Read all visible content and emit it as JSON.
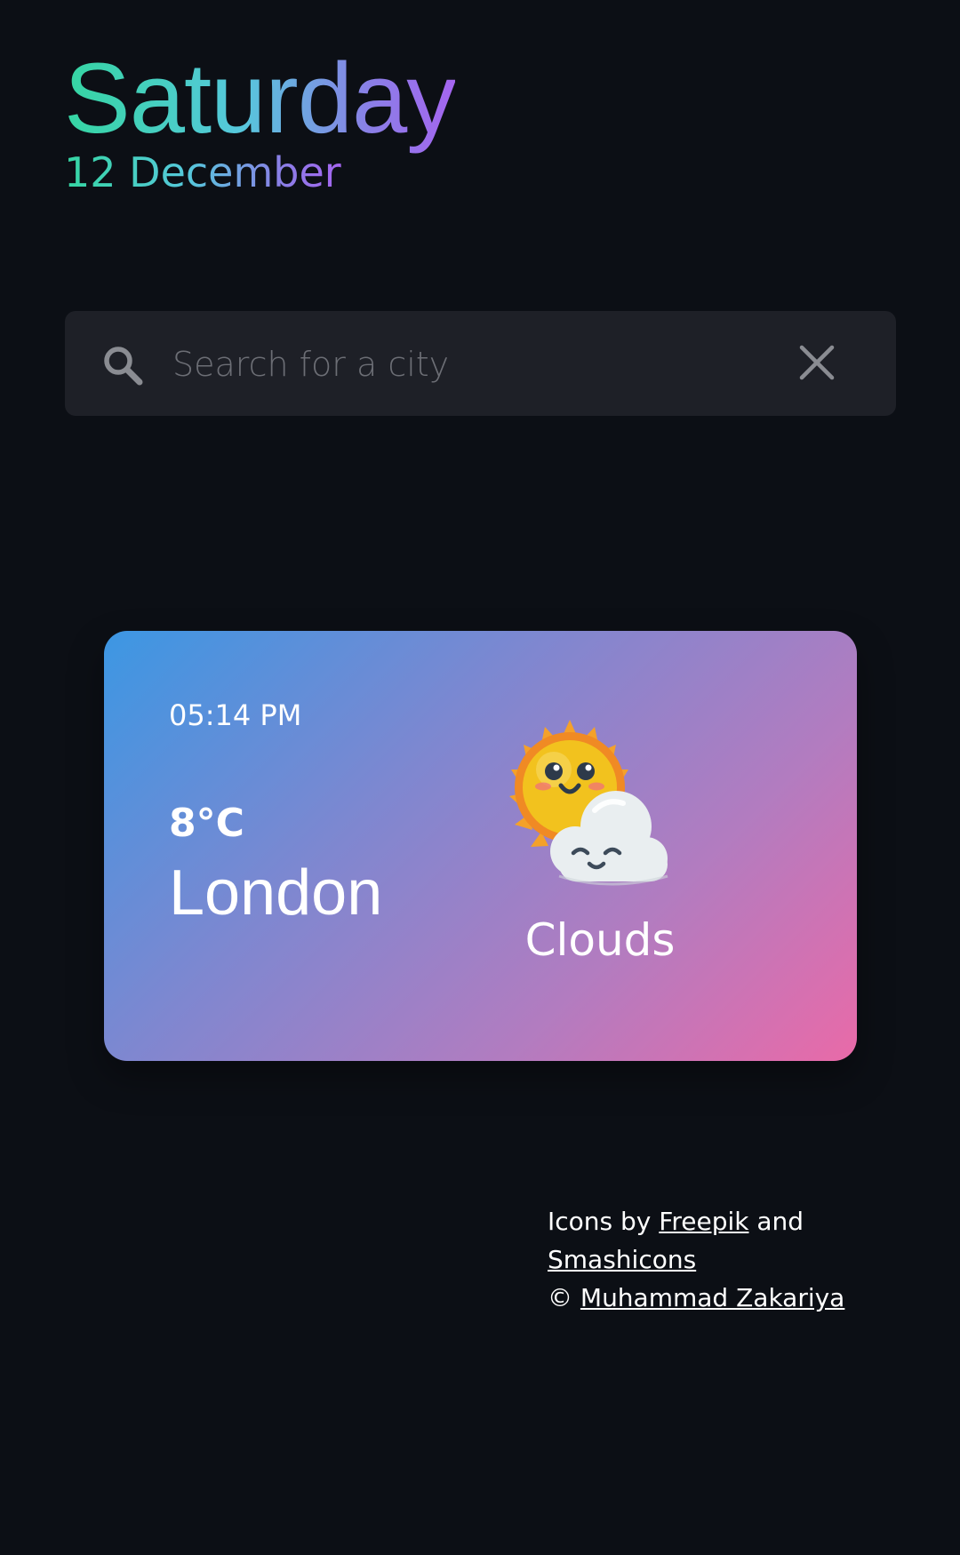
{
  "header": {
    "day": "Saturday",
    "date": "12 December"
  },
  "search": {
    "placeholder": "Search for a city",
    "value": "",
    "icon": "search-icon",
    "clear_icon": "close-icon"
  },
  "weather_card": {
    "time": "05:14 PM",
    "temperature": "8°C",
    "city": "London",
    "condition": "Clouds",
    "icon": "sun-behind-cloud-icon"
  },
  "footer": {
    "prefix": "Icons by",
    "link1": "Freepik",
    "conjunction": "and",
    "link2": "Smashicons",
    "copyright_symbol": "©",
    "author": "Muhammad Zakariya"
  },
  "colors": {
    "background": "#0c0f15",
    "search_bg": "#1e2027",
    "accent_start": "#35d6a2",
    "accent_end": "#a565f0",
    "card_gradient_start": "#3c97e3",
    "card_gradient_end": "#e96aa8"
  }
}
